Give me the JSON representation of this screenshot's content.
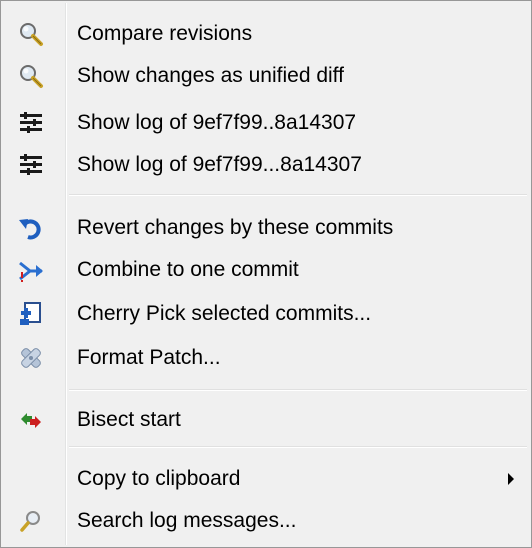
{
  "menu": {
    "items": [
      {
        "label": "Compare revisions",
        "icon": "magnifier-icon"
      },
      {
        "label": "Show changes as unified diff",
        "icon": "magnifier-icon"
      },
      {
        "label": "Show log of 9ef7f99..8a14307",
        "icon": "log-icon"
      },
      {
        "label": "Show log of 9ef7f99...8a14307",
        "icon": "log-icon"
      },
      {
        "label": "Revert changes by these commits",
        "icon": "revert-icon"
      },
      {
        "label": "Combine to one commit",
        "icon": "combine-icon"
      },
      {
        "label": "Cherry Pick selected commits...",
        "icon": "cherry-pick-icon"
      },
      {
        "label": "Format Patch...",
        "icon": "patch-icon"
      },
      {
        "label": "Bisect start",
        "icon": "bisect-icon"
      },
      {
        "label": "Copy to clipboard",
        "icon": "none",
        "submenu": true
      },
      {
        "label": "Search log messages...",
        "icon": "search-icon"
      }
    ]
  },
  "colors": {
    "background": "#f0f0f0",
    "border": "#979797",
    "text": "#000000",
    "revert_blue": "#1f5fbf",
    "bisect_green": "#2e8b2e",
    "bisect_red": "#cc1f1f"
  }
}
